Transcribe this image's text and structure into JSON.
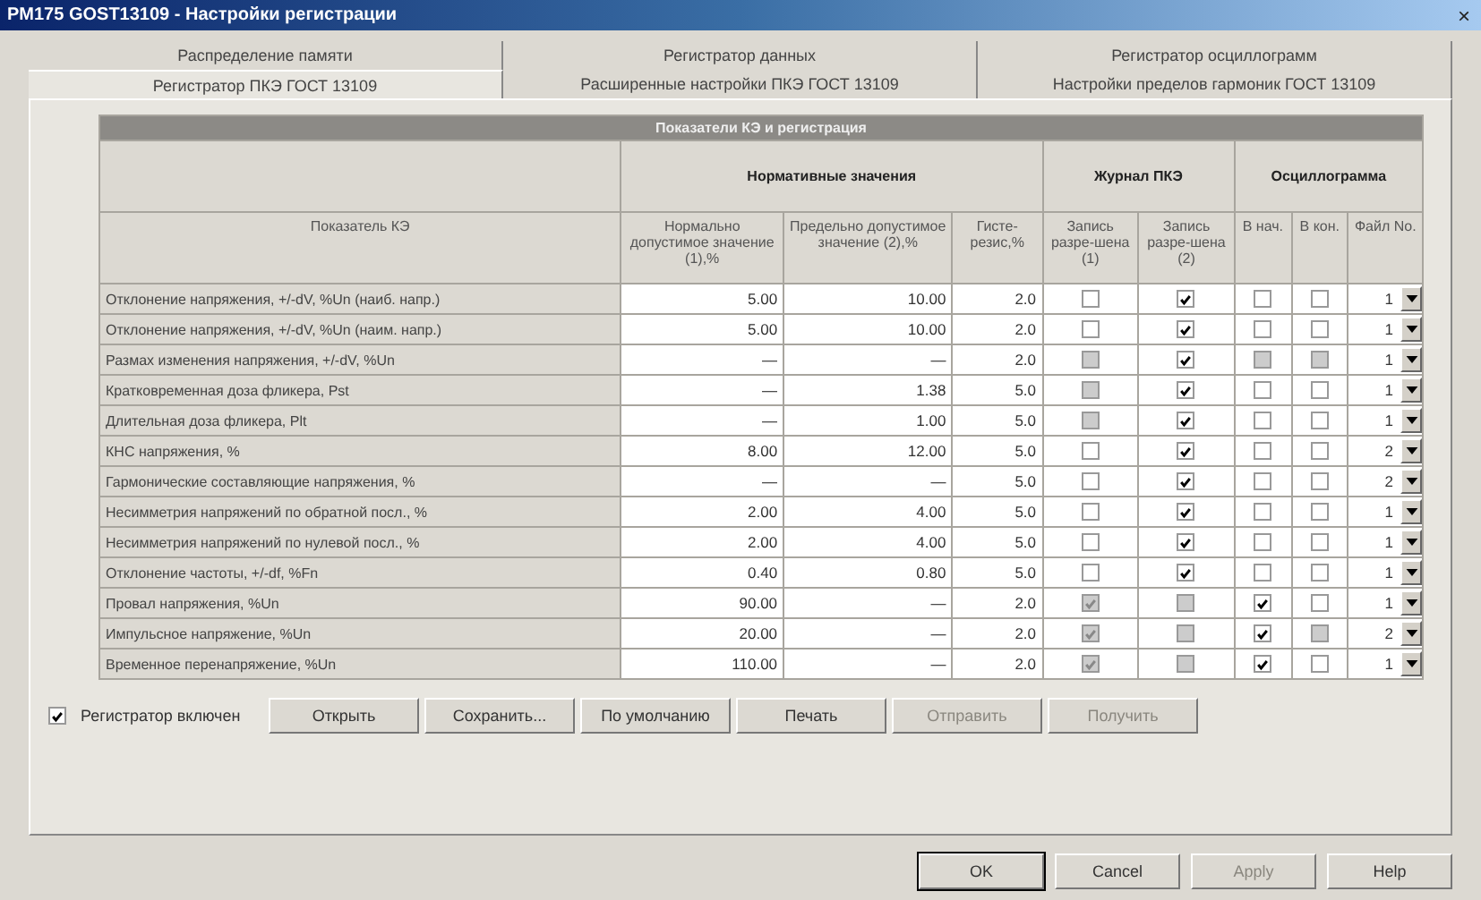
{
  "window": {
    "title": "PM175 GOST13109 - Настройки регистрации",
    "close": "×"
  },
  "tab_rows": [
    [
      {
        "label": "Распределение памяти",
        "selected": false
      },
      {
        "label": "Регистратор данных",
        "selected": false
      },
      {
        "label": "Регистратор осциллограмм",
        "selected": false
      }
    ],
    [
      {
        "label": "Регистратор ПКЭ ГОСТ 13109",
        "selected": true
      },
      {
        "label": "Расширенные настройки ПКЭ ГОСТ 13109",
        "selected": false
      },
      {
        "label": "Настройки пределов гармоник ГОСТ 13109",
        "selected": false
      }
    ]
  ],
  "table": {
    "title": "Показатели КЭ и регистрация",
    "groups": [
      "Нормативные значения",
      "Журнал ПКЭ",
      "Осциллограмма"
    ],
    "columns": [
      "Показатель КЭ",
      "Нормально допустимое значение (1),%",
      "Предельно допустимое значение (2),%",
      "Гисте-резис,%",
      "Запись разре-шена (1)",
      "Запись разре-шена (2)",
      "В нач.",
      "В кон.",
      "Файл No."
    ],
    "rows": [
      {
        "name": "Отклонение напряжения, +/-dV, %Un (наиб. напр.)",
        "norm": "5.00",
        "limit": "10.00",
        "hyst": "2.0",
        "rec1": {
          "checked": false,
          "disabled": false
        },
        "rec2": {
          "checked": true,
          "disabled": false
        },
        "start": {
          "checked": false,
          "disabled": false
        },
        "end": {
          "checked": false,
          "disabled": false
        },
        "file": "1"
      },
      {
        "name": "Отклонение напряжения, +/-dV, %Un (наим. напр.)",
        "norm": "5.00",
        "limit": "10.00",
        "hyst": "2.0",
        "rec1": {
          "checked": false,
          "disabled": false
        },
        "rec2": {
          "checked": true,
          "disabled": false
        },
        "start": {
          "checked": false,
          "disabled": false
        },
        "end": {
          "checked": false,
          "disabled": false
        },
        "file": "1"
      },
      {
        "name": "Размах изменения напряжения, +/-dV, %Un",
        "norm": "—",
        "limit": "—",
        "hyst": "2.0",
        "rec1": {
          "checked": false,
          "disabled": true
        },
        "rec2": {
          "checked": true,
          "disabled": false
        },
        "start": {
          "checked": false,
          "disabled": true
        },
        "end": {
          "checked": false,
          "disabled": true
        },
        "file": "1"
      },
      {
        "name": "Кратковременная доза фликера, Pst",
        "norm": "—",
        "limit": "1.38",
        "hyst": "5.0",
        "rec1": {
          "checked": false,
          "disabled": true
        },
        "rec2": {
          "checked": true,
          "disabled": false
        },
        "start": {
          "checked": false,
          "disabled": false
        },
        "end": {
          "checked": false,
          "disabled": false
        },
        "file": "1"
      },
      {
        "name": "Длительная доза фликера, Plt",
        "norm": "—",
        "limit": "1.00",
        "hyst": "5.0",
        "rec1": {
          "checked": false,
          "disabled": true
        },
        "rec2": {
          "checked": true,
          "disabled": false
        },
        "start": {
          "checked": false,
          "disabled": false
        },
        "end": {
          "checked": false,
          "disabled": false
        },
        "file": "1"
      },
      {
        "name": "КНС напряжения, %",
        "norm": "8.00",
        "limit": "12.00",
        "hyst": "5.0",
        "rec1": {
          "checked": false,
          "disabled": false
        },
        "rec2": {
          "checked": true,
          "disabled": false
        },
        "start": {
          "checked": false,
          "disabled": false
        },
        "end": {
          "checked": false,
          "disabled": false
        },
        "file": "2"
      },
      {
        "name": "Гармонические составляющие напряжения, %",
        "norm": "—",
        "limit": "—",
        "hyst": "5.0",
        "rec1": {
          "checked": false,
          "disabled": false
        },
        "rec2": {
          "checked": true,
          "disabled": false
        },
        "start": {
          "checked": false,
          "disabled": false
        },
        "end": {
          "checked": false,
          "disabled": false
        },
        "file": "2"
      },
      {
        "name": "Несимметрия напряжений по обратной посл., %",
        "norm": "2.00",
        "limit": "4.00",
        "hyst": "5.0",
        "rec1": {
          "checked": false,
          "disabled": false
        },
        "rec2": {
          "checked": true,
          "disabled": false
        },
        "start": {
          "checked": false,
          "disabled": false
        },
        "end": {
          "checked": false,
          "disabled": false
        },
        "file": "1"
      },
      {
        "name": "Несимметрия напряжений по нулевой посл., %",
        "norm": "2.00",
        "limit": "4.00",
        "hyst": "5.0",
        "rec1": {
          "checked": false,
          "disabled": false
        },
        "rec2": {
          "checked": true,
          "disabled": false
        },
        "start": {
          "checked": false,
          "disabled": false
        },
        "end": {
          "checked": false,
          "disabled": false
        },
        "file": "1"
      },
      {
        "name": "Отклонение частоты, +/-df, %Fn",
        "norm": "0.40",
        "limit": "0.80",
        "hyst": "5.0",
        "rec1": {
          "checked": false,
          "disabled": false
        },
        "rec2": {
          "checked": true,
          "disabled": false
        },
        "start": {
          "checked": false,
          "disabled": false
        },
        "end": {
          "checked": false,
          "disabled": false
        },
        "file": "1"
      },
      {
        "name": "Провал напряжения, %Un",
        "norm": "90.00",
        "limit": "—",
        "hyst": "2.0",
        "rec1": {
          "checked": true,
          "disabled": true
        },
        "rec2": {
          "checked": false,
          "disabled": true
        },
        "start": {
          "checked": true,
          "disabled": false
        },
        "end": {
          "checked": false,
          "disabled": false
        },
        "file": "1"
      },
      {
        "name": "Импульсное напряжение, %Un",
        "norm": "20.00",
        "limit": "—",
        "hyst": "2.0",
        "rec1": {
          "checked": true,
          "disabled": true
        },
        "rec2": {
          "checked": false,
          "disabled": true
        },
        "start": {
          "checked": true,
          "disabled": false
        },
        "end": {
          "checked": false,
          "disabled": true
        },
        "file": "2"
      },
      {
        "name": "Временное перенапряжение, %Un",
        "norm": "110.00",
        "limit": "—",
        "hyst": "2.0",
        "rec1": {
          "checked": true,
          "disabled": true
        },
        "rec2": {
          "checked": false,
          "disabled": true
        },
        "start": {
          "checked": true,
          "disabled": false
        },
        "end": {
          "checked": false,
          "disabled": false
        },
        "file": "1"
      }
    ]
  },
  "recorder_enabled": {
    "label": "Регистратор включен",
    "checked": true
  },
  "actions": [
    {
      "label": "Открыть",
      "disabled": false
    },
    {
      "label": "Сохранить...",
      "disabled": false
    },
    {
      "label": "По умолчанию",
      "disabled": false
    },
    {
      "label": "Печать",
      "disabled": false
    },
    {
      "label": "Отправить",
      "disabled": true
    },
    {
      "label": "Получить",
      "disabled": true
    }
  ],
  "dialog_buttons": [
    {
      "label": "OK",
      "disabled": false
    },
    {
      "label": "Cancel",
      "disabled": false
    },
    {
      "label": "Apply",
      "disabled": true
    },
    {
      "label": "Help",
      "disabled": false
    }
  ]
}
